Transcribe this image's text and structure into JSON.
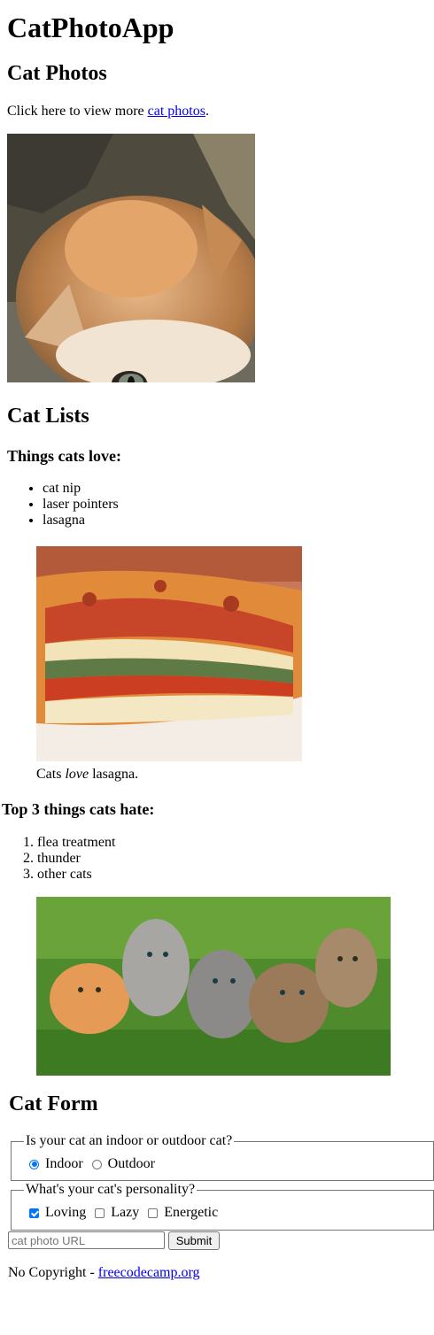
{
  "main": {
    "title": "CatPhotoApp",
    "photos_section": {
      "heading": "Cat Photos",
      "intro_text": "Click here to view more ",
      "link_text": "cat photos",
      "after_link": ".",
      "image_alt": "A cute orange cat lying on its back."
    },
    "lists_section": {
      "heading": "Cat Lists",
      "love_heading": "Things cats love:",
      "love_items": [
        "cat nip",
        "laser pointers",
        "lasagna"
      ],
      "lasagna_caption_pre": "Cats ",
      "lasagna_caption_em": "love",
      "lasagna_caption_post": " lasagna.",
      "hate_heading": "Top 3 things cats hate:",
      "hate_items": [
        "flea treatment",
        "thunder",
        "other cats"
      ]
    },
    "form_section": {
      "heading": "Cat Form",
      "location_legend": "Is your cat an indoor or outdoor cat?",
      "location_options": [
        {
          "label": "Indoor",
          "checked": true
        },
        {
          "label": "Outdoor",
          "checked": false
        }
      ],
      "personality_legend": "What's your cat's personality?",
      "personality_options": [
        {
          "label": "Loving",
          "checked": true
        },
        {
          "label": "Lazy",
          "checked": false
        },
        {
          "label": "Energetic",
          "checked": false
        }
      ],
      "url_placeholder": "cat photo URL",
      "submit_label": "Submit"
    }
  },
  "footer": {
    "text": "No Copyright - ",
    "link_text": "freecodecamp.org"
  },
  "colors": {
    "link": "#0000ee",
    "accent": "#0075ff",
    "border": "#767676"
  }
}
